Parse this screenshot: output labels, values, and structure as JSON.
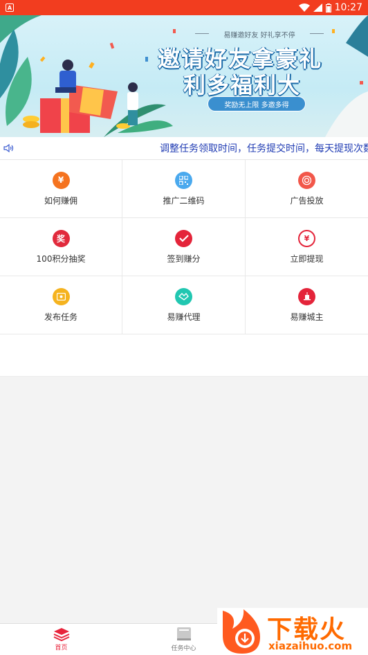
{
  "status_bar": {
    "time": "10:27"
  },
  "banner": {
    "tagline": "易赚邀好友  好礼享不停",
    "title_line1": "邀请好友拿豪礼",
    "title_line2": "利多福利大",
    "pill": "奖励无上限 多邀多得"
  },
  "marquee": {
    "text": "调整任务领取时间，任务提交时间，每天提现次数"
  },
  "grid": [
    {
      "label": "如何赚佣",
      "icon": "yuan-hand-icon",
      "color": "#f5731f",
      "glyph": "¥"
    },
    {
      "label": "推广二维码",
      "icon": "qrcode-icon",
      "color": "#4aa9ee",
      "glyph": "▦"
    },
    {
      "label": "广告投放",
      "icon": "target-icon",
      "color": "#f2574a",
      "glyph": "◎"
    },
    {
      "label": "100积分抽奖",
      "icon": "prize-icon",
      "color": "#e12a3c",
      "glyph": "奖"
    },
    {
      "label": "签到赚分",
      "icon": "check-icon",
      "color": "#e4243a",
      "glyph": "✓"
    },
    {
      "label": "立即提现",
      "icon": "withdraw-icon",
      "color": "#ffffff",
      "glyph": "¥"
    },
    {
      "label": "发布任务",
      "icon": "publish-icon",
      "color": "#f5b31f",
      "glyph": "▣"
    },
    {
      "label": "易赚代理",
      "icon": "handshake-icon",
      "color": "#21c7b1",
      "glyph": "⇄"
    },
    {
      "label": "易赚城主",
      "icon": "city-icon",
      "color": "#e4243a",
      "glyph": "▲"
    }
  ],
  "bottom_nav": [
    {
      "label": "首页",
      "active": true
    },
    {
      "label": "任务中心",
      "active": false
    }
  ],
  "watermark": {
    "brand": "下载火",
    "url": "xiazaihuo.com"
  }
}
